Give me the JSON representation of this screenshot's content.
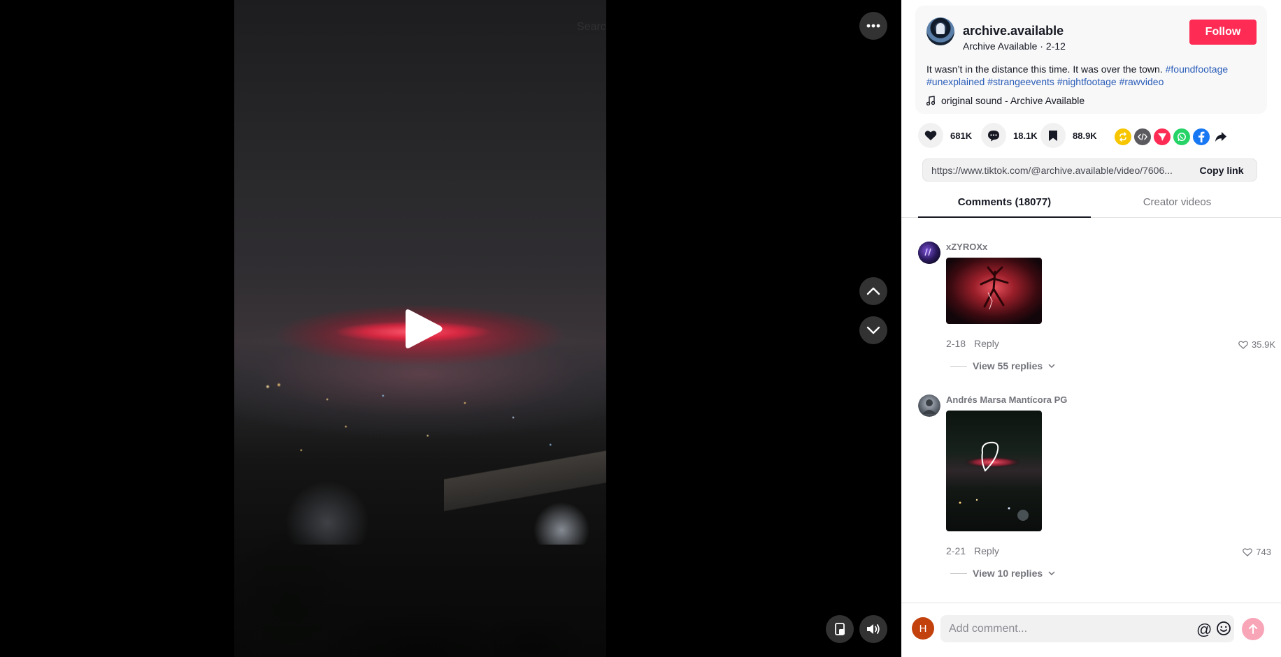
{
  "video": {
    "search_ghost": "Search",
    "controls": {
      "more": "more-options",
      "prev": "previous-video",
      "next": "next-video",
      "pip": "picture-in-picture",
      "volume": "volume"
    }
  },
  "author": {
    "username": "archive.available",
    "display_name": "Archive Available",
    "date": "2-12",
    "follow_label": "Follow"
  },
  "description": {
    "text": "It wasn’t in the distance this time. It was over the town.",
    "hashtags": [
      "#foundfootage",
      "#unexplained",
      "#strangeevents",
      "#nightfootage",
      "#rawvideo"
    ]
  },
  "music": {
    "label": "original sound - Archive Available"
  },
  "stats": {
    "likes": "681K",
    "comments": "18.1K",
    "saves": "88.9K"
  },
  "share_icons": [
    "repost-icon",
    "embed-icon",
    "send-to-friends-icon",
    "whatsapp-icon",
    "facebook-icon",
    "share-arrow-icon"
  ],
  "colors": {
    "brand_red": "#fe2c55",
    "hashtag_blue": "#2b5db9",
    "repost_yellow": "#f7c600",
    "embed_gray": "#5a5a5f",
    "send_red": "#fe2c55",
    "whatsapp_green": "#25d366",
    "facebook_blue": "#1877f2"
  },
  "link": {
    "url": "https://www.tiktok.com/@archive.available/video/7606...",
    "copy_label": "Copy link"
  },
  "tabs": [
    {
      "label": "Comments (18077)",
      "active": true
    },
    {
      "label": "Creator videos",
      "active": false
    }
  ],
  "comments": [
    {
      "user": "xZYROXx",
      "date": "2-18",
      "reply_label": "Reply",
      "likes": "35.9K",
      "view_replies": "View 55 replies"
    },
    {
      "user": "Andrés Marsa Mantícora PG",
      "date": "2-21",
      "reply_label": "Reply",
      "likes": "743",
      "view_replies": "View 10 replies"
    }
  ],
  "comment_bar": {
    "avatar_initial": "H",
    "placeholder": "Add comment...",
    "mention_symbol": "@"
  }
}
